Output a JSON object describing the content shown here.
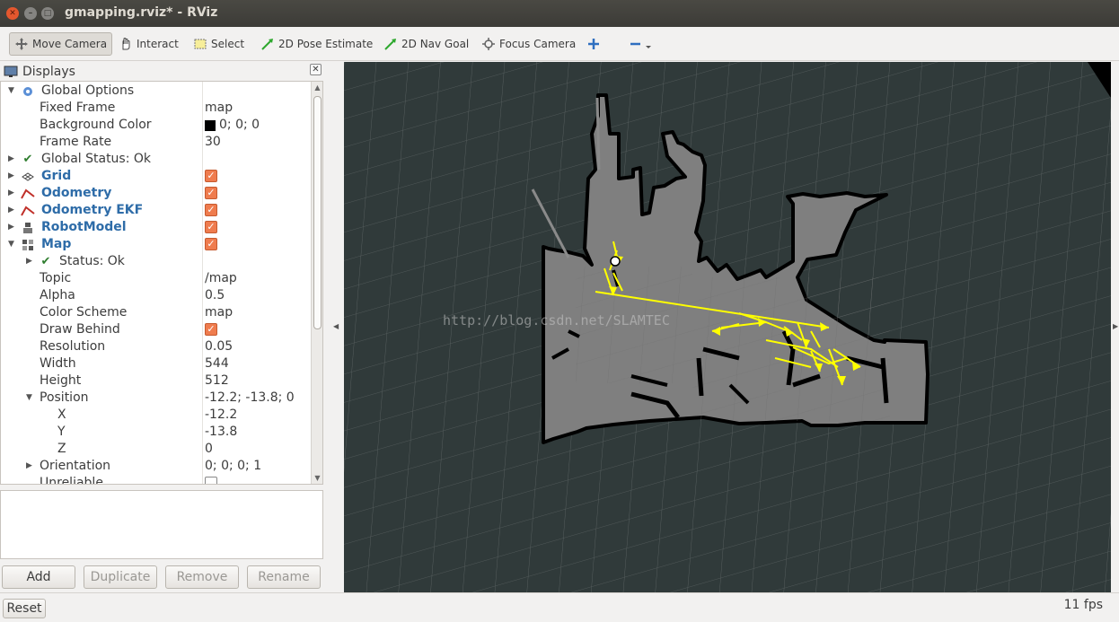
{
  "window": {
    "title": "gmapping.rviz* - RViz"
  },
  "toolbar": {
    "tools": [
      {
        "label": "Move Camera",
        "icon": "move-camera-icon"
      },
      {
        "label": "Interact",
        "icon": "hand-icon"
      },
      {
        "label": "Select",
        "icon": "select-box-icon"
      },
      {
        "label": "2D Pose Estimate",
        "icon": "pose-arrow-icon"
      },
      {
        "label": "2D Nav Goal",
        "icon": "nav-goal-arrow-icon"
      },
      {
        "label": "Focus Camera",
        "icon": "focus-icon"
      }
    ],
    "active_tool": "Move Camera"
  },
  "displays_panel": {
    "title": "Displays",
    "rows": [
      {
        "name": "Global Options",
        "value": ""
      },
      {
        "name": "Fixed Frame",
        "value": "map"
      },
      {
        "name": "Background Color",
        "value": "0; 0; 0"
      },
      {
        "name": "Frame Rate",
        "value": "30"
      },
      {
        "name": "Global Status: Ok",
        "value": ""
      },
      {
        "name": "Grid",
        "value": ""
      },
      {
        "name": "Odometry",
        "value": ""
      },
      {
        "name": "Odometry EKF",
        "value": ""
      },
      {
        "name": "RobotModel",
        "value": ""
      },
      {
        "name": "Map",
        "value": ""
      },
      {
        "name": "Status: Ok",
        "value": ""
      },
      {
        "name": "Topic",
        "value": "/map"
      },
      {
        "name": "Alpha",
        "value": "0.5"
      },
      {
        "name": "Color Scheme",
        "value": "map"
      },
      {
        "name": "Draw Behind",
        "value": ""
      },
      {
        "name": "Resolution",
        "value": "0.05"
      },
      {
        "name": "Width",
        "value": "544"
      },
      {
        "name": "Height",
        "value": "512"
      },
      {
        "name": "Position",
        "value": "-12.2; -13.8; 0"
      },
      {
        "name": "X",
        "value": "-12.2"
      },
      {
        "name": "Y",
        "value": "-13.8"
      },
      {
        "name": "Z",
        "value": "0"
      },
      {
        "name": "Orientation",
        "value": "0; 0; 0; 1"
      },
      {
        "name": "Unreliable",
        "value": ""
      }
    ],
    "buttons": {
      "add": "Add",
      "duplicate": "Duplicate",
      "remove": "Remove",
      "rename": "Rename"
    }
  },
  "viewport": {
    "background_color": "#303a3a",
    "map_free_color": "#7f7f7f",
    "map_wall_color": "#000000",
    "trajectory_color": "#ffff00",
    "watermark": "http://blog.csdn.net/SLAMTEC"
  },
  "statusbar": {
    "reset": "Reset",
    "fps": "11 fps"
  }
}
